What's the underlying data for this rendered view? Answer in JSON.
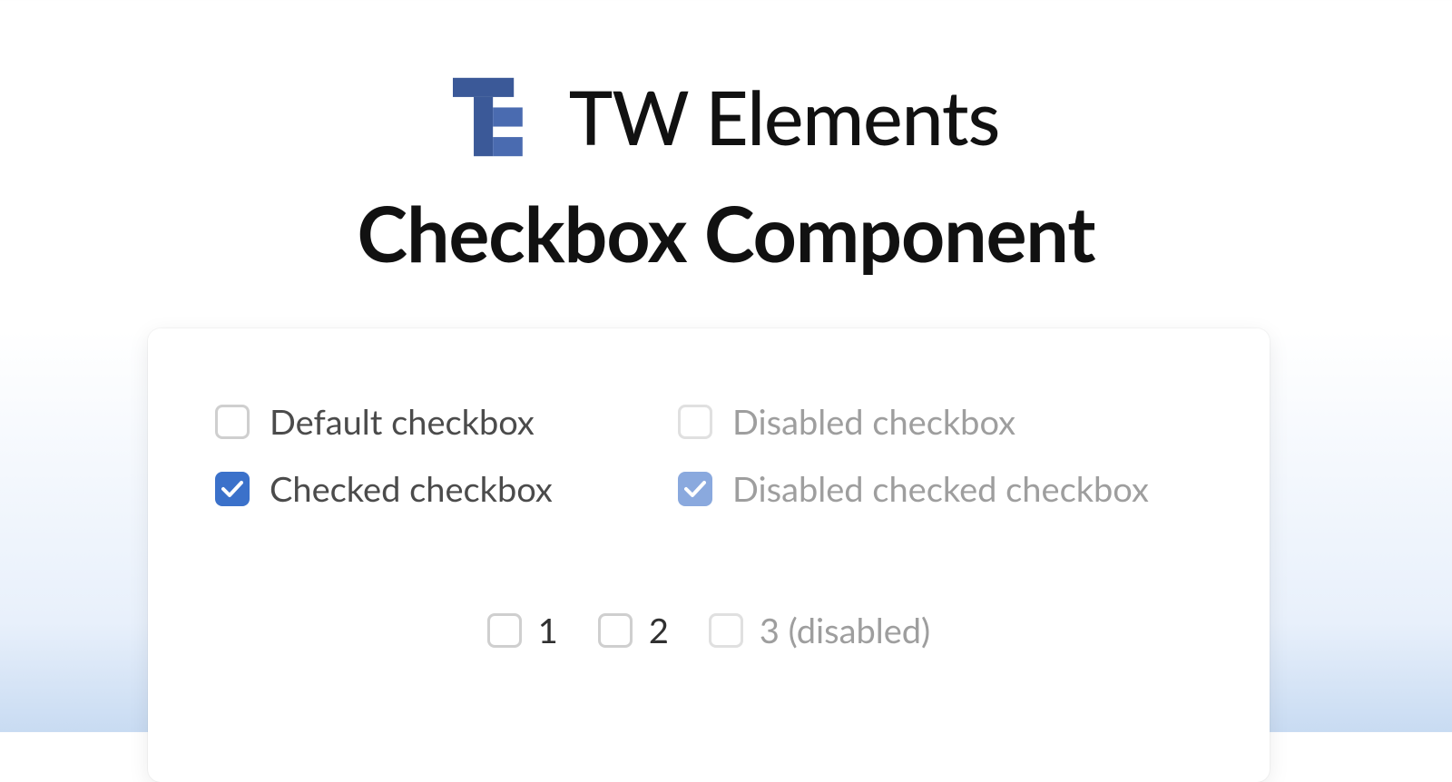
{
  "brand": {
    "title": "TW Elements",
    "logo_color_primary": "#3b5998",
    "logo_color_secondary": "#4a6bb0"
  },
  "page": {
    "subtitle": "Checkbox Component"
  },
  "checkboxes": {
    "default": {
      "label": "Default checkbox",
      "checked": false,
      "disabled": false
    },
    "checked": {
      "label": "Checked checkbox",
      "checked": true,
      "disabled": false
    },
    "disabled": {
      "label": "Disabled checkbox",
      "checked": false,
      "disabled": true
    },
    "disabled_checked": {
      "label": "Disabled checked checkbox",
      "checked": true,
      "disabled": true
    }
  },
  "inline": {
    "items": [
      {
        "label": "1",
        "checked": false,
        "disabled": false
      },
      {
        "label": "2",
        "checked": false,
        "disabled": false
      },
      {
        "label": "3 (disabled)",
        "checked": false,
        "disabled": true
      }
    ]
  },
  "colors": {
    "checkbox_checked": "#3b71ca",
    "checkbox_disabled_checked": "#8aa9de",
    "label": "#4b4b4b",
    "label_disabled": "#9e9e9e"
  }
}
